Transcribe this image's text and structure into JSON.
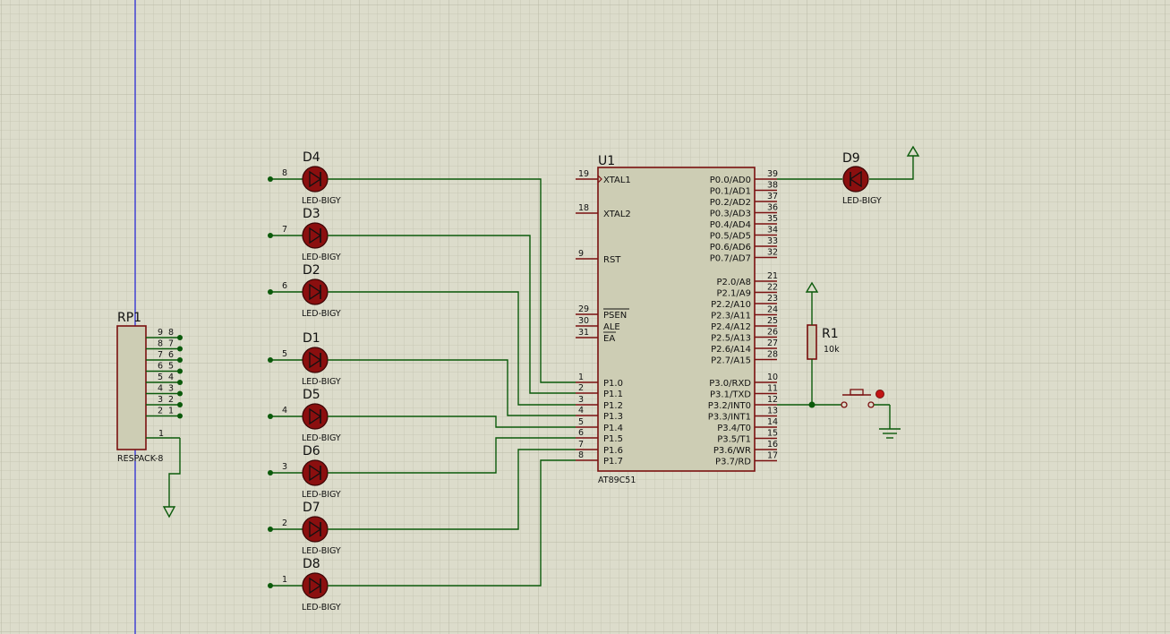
{
  "colors": {
    "background": "#dcdccb",
    "grid_minor": "#c7c7b4",
    "grid_major": "#b8b8a4",
    "wire": "#0b5a0b",
    "component_body": "#cdcdb4",
    "component_outline": "#7a1010",
    "led_fill": "#8b0f0f",
    "origin_line": "#2b2bd6"
  },
  "mcu": {
    "ref": "U1",
    "part": "AT89C51",
    "left_pins": [
      {
        "num": "19",
        "name": "XTAL1"
      },
      {
        "num": "18",
        "name": "XTAL2"
      },
      {
        "num": "9",
        "name": "RST"
      },
      {
        "num": "29",
        "name": "PSEN"
      },
      {
        "num": "30",
        "name": "ALE"
      },
      {
        "num": "31",
        "name": "EA"
      },
      {
        "num": "1",
        "name": "P1.0"
      },
      {
        "num": "2",
        "name": "P1.1"
      },
      {
        "num": "3",
        "name": "P1.2"
      },
      {
        "num": "4",
        "name": "P1.3"
      },
      {
        "num": "5",
        "name": "P1.4"
      },
      {
        "num": "6",
        "name": "P1.5"
      },
      {
        "num": "7",
        "name": "P1.6"
      },
      {
        "num": "8",
        "name": "P1.7"
      }
    ],
    "right_pins": [
      {
        "num": "39",
        "name": "P0.0/AD0"
      },
      {
        "num": "38",
        "name": "P0.1/AD1"
      },
      {
        "num": "37",
        "name": "P0.2/AD2"
      },
      {
        "num": "36",
        "name": "P0.3/AD3"
      },
      {
        "num": "35",
        "name": "P0.4/AD4"
      },
      {
        "num": "34",
        "name": "P0.5/AD5"
      },
      {
        "num": "33",
        "name": "P0.6/AD6"
      },
      {
        "num": "32",
        "name": "P0.7/AD7"
      },
      {
        "num": "21",
        "name": "P2.0/A8"
      },
      {
        "num": "22",
        "name": "P2.1/A9"
      },
      {
        "num": "23",
        "name": "P2.2/A10"
      },
      {
        "num": "24",
        "name": "P2.3/A11"
      },
      {
        "num": "25",
        "name": "P2.4/A12"
      },
      {
        "num": "26",
        "name": "P2.5/A13"
      },
      {
        "num": "27",
        "name": "P2.6/A14"
      },
      {
        "num": "28",
        "name": "P2.7/A15"
      },
      {
        "num": "10",
        "name": "P3.0/RXD"
      },
      {
        "num": "11",
        "name": "P3.1/TXD"
      },
      {
        "num": "12",
        "name": "P3.2/INT0"
      },
      {
        "num": "13",
        "name": "P3.3/INT1"
      },
      {
        "num": "14",
        "name": "P3.4/T0"
      },
      {
        "num": "15",
        "name": "P3.5/T1"
      },
      {
        "num": "16",
        "name": "P3.6/WR"
      },
      {
        "num": "17",
        "name": "P3.7/RD"
      }
    ]
  },
  "leds": [
    {
      "ref": "D4",
      "part": "LED-BIGY",
      "net": "8"
    },
    {
      "ref": "D3",
      "part": "LED-BIGY",
      "net": "7"
    },
    {
      "ref": "D2",
      "part": "LED-BIGY",
      "net": "6"
    },
    {
      "ref": "D1",
      "part": "LED-BIGY",
      "net": "5"
    },
    {
      "ref": "D5",
      "part": "LED-BIGY",
      "net": "4"
    },
    {
      "ref": "D6",
      "part": "LED-BIGY",
      "net": "3"
    },
    {
      "ref": "D7",
      "part": "LED-BIGY",
      "net": "2"
    },
    {
      "ref": "D8",
      "part": "LED-BIGY",
      "net": "1"
    }
  ],
  "d9": {
    "ref": "D9",
    "part": "LED-BIGY"
  },
  "r1": {
    "ref": "R1",
    "value": "10k"
  },
  "respack": {
    "ref": "RP1",
    "part": "RESPACK-8",
    "pin_pairs": [
      [
        "9",
        "8"
      ],
      [
        "8",
        "7"
      ],
      [
        "7",
        "6"
      ],
      [
        "6",
        "5"
      ],
      [
        "5",
        "4"
      ],
      [
        "4",
        "3"
      ],
      [
        "3",
        "2"
      ],
      [
        "2",
        "1"
      ]
    ],
    "common_pin": "1"
  }
}
